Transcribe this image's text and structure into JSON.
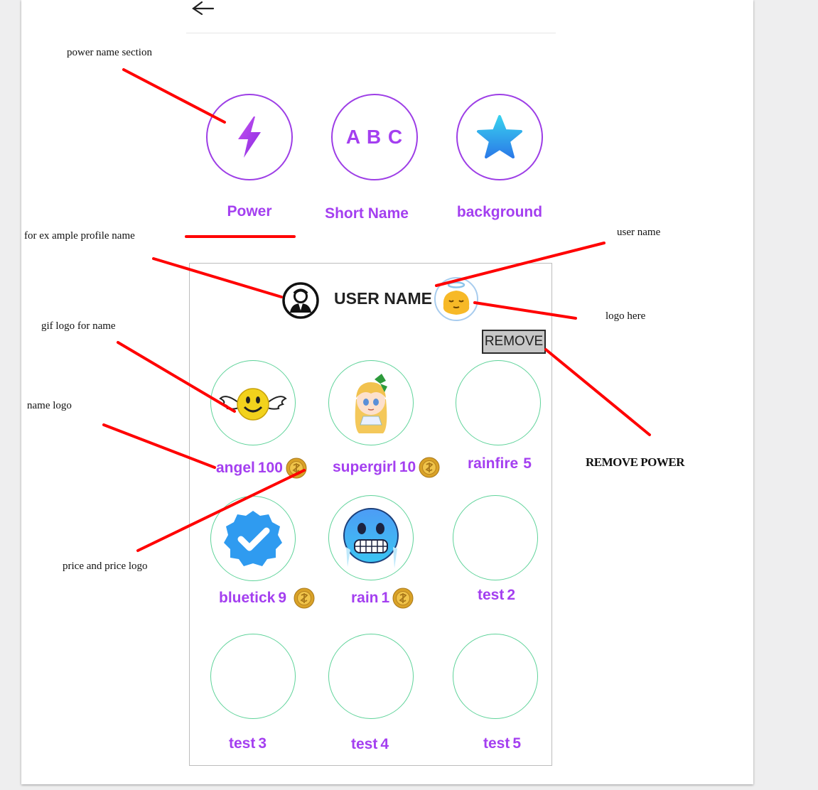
{
  "tabs": [
    {
      "label": "Power",
      "icon": "lightning-icon"
    },
    {
      "label": "Short Name",
      "icon": "abc-text-icon",
      "icon_text": "A B C"
    },
    {
      "label": "background",
      "icon": "star-icon"
    }
  ],
  "profile": {
    "name": "USER NAME",
    "avatar_icon": "user-avatar-icon",
    "logo_icon": "angel-emoji-icon"
  },
  "remove_button": {
    "label": "REMOVE"
  },
  "powers": [
    {
      "name": "angel",
      "price": "100",
      "icon": "winged-smiley-icon",
      "has_coin": true
    },
    {
      "name": "supergirl",
      "price": "10",
      "icon": "anime-girl-icon",
      "has_coin": true
    },
    {
      "name": "rainfire",
      "price": "5",
      "icon": "",
      "has_coin": false
    },
    {
      "name": "bluetick",
      "price": "9",
      "icon": "verified-badge-icon",
      "has_coin": true
    },
    {
      "name": "rain",
      "price": "1",
      "icon": "freezing-face-icon",
      "has_coin": true
    },
    {
      "name": "test",
      "price": "2",
      "icon": "",
      "has_coin": false
    },
    {
      "name": "test",
      "price": "3",
      "icon": "",
      "has_coin": false
    },
    {
      "name": "test",
      "price": "4",
      "icon": "",
      "has_coin": false
    },
    {
      "name": "test",
      "price": "5",
      "icon": "",
      "has_coin": false
    }
  ],
  "annotations": {
    "power_name_section": "power name section",
    "profile_name": "for ex ample profile name",
    "user_name": "user name",
    "logo_here": "logo here",
    "gif_logo": "gif logo for name",
    "name_logo": "name logo",
    "price_logo": "price and price logo",
    "remove_power": "REMOVE POWER"
  },
  "colors": {
    "accent_purple": "#a43ff0",
    "circle_border_green": "#5fd39a",
    "arrow_red": "#ff0000",
    "coin_gold": "#d9a227"
  }
}
